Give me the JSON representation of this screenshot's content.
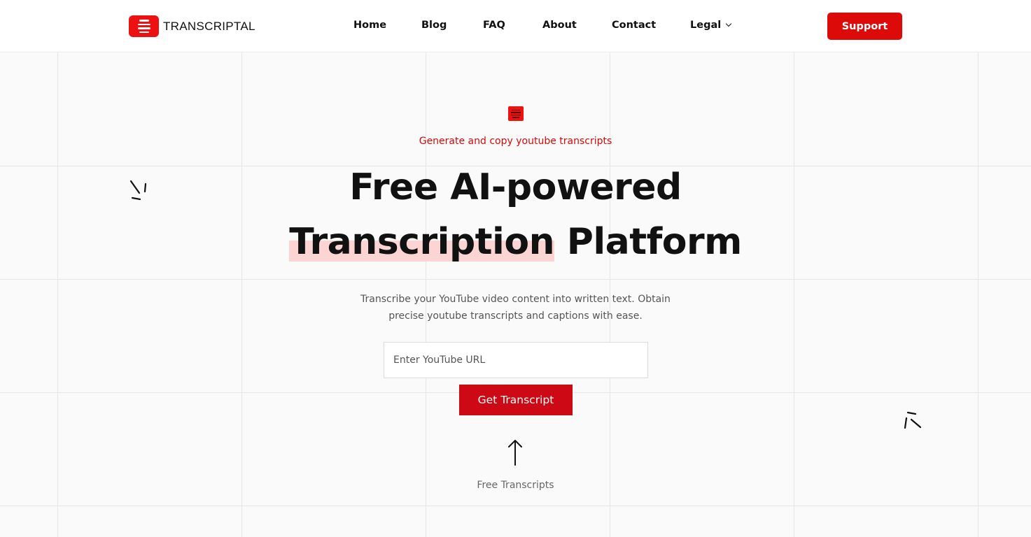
{
  "brand": {
    "name": "TRANSCRIPTAL",
    "accent": "#ee1111"
  },
  "nav": {
    "items": [
      {
        "label": "Home"
      },
      {
        "label": "Blog"
      },
      {
        "label": "FAQ"
      },
      {
        "label": "About"
      },
      {
        "label": "Contact"
      },
      {
        "label": "Legal"
      }
    ],
    "support_label": "Support"
  },
  "hero": {
    "tagline": "Generate and copy youtube transcripts",
    "title_line1": "Free AI-powered",
    "title_highlight": "Transcription",
    "title_rest": " Platform",
    "description": "Transcribe your YouTube video content into written text. Obtain precise youtube transcripts and captions with ease.",
    "url_placeholder": "Enter YouTube URL",
    "button_label": "Get Transcript",
    "below_label": "Free Transcripts"
  },
  "icons": {
    "logo": "transcript-lines-icon",
    "hero": "document-icon",
    "arrow": "arrow-up-icon",
    "decor": "sparkle-icon"
  }
}
